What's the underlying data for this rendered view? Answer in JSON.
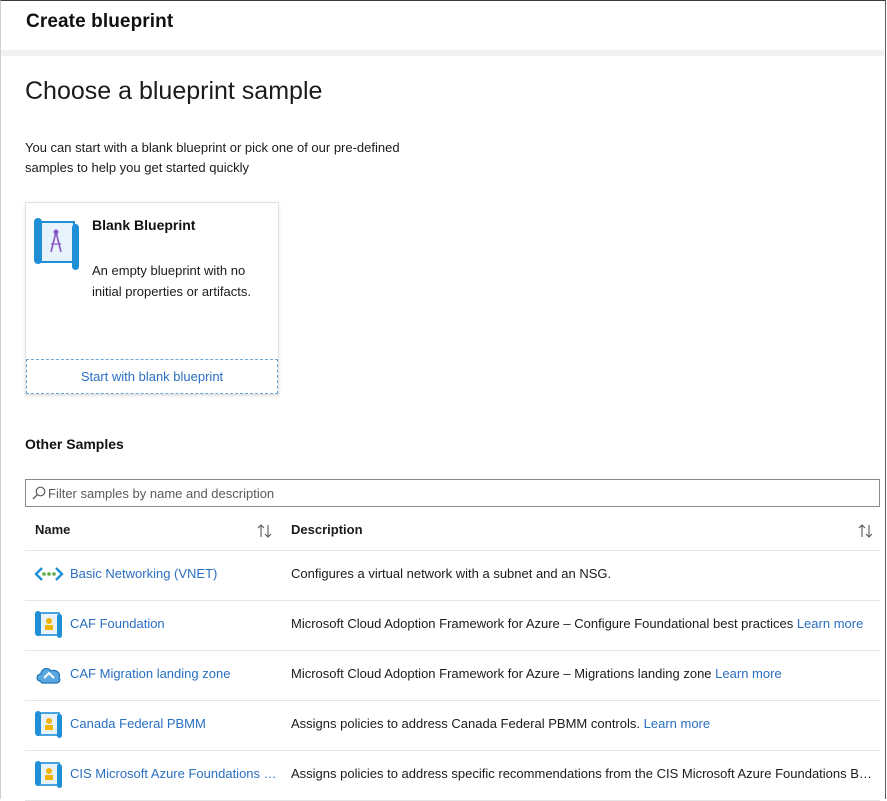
{
  "header": {
    "title": "Create blueprint"
  },
  "page": {
    "heading": "Choose a blueprint sample",
    "intro": "You can start with a blank blueprint or pick one of our pre-defined samples to help you get started quickly"
  },
  "blank_card": {
    "title": "Blank Blueprint",
    "description": "An empty blueprint with no initial properties or artifacts.",
    "action_label": "Start with blank blueprint"
  },
  "other_samples": {
    "heading": "Other Samples",
    "filter_placeholder": "Filter samples by name and description",
    "filter_value": "",
    "columns": {
      "name": "Name",
      "description": "Description"
    },
    "rows": [
      {
        "icon": "network-icon",
        "name": "Basic Networking (VNET)",
        "description": "Configures a virtual network with a subnet and an NSG.",
        "link": ""
      },
      {
        "icon": "blueprint-icon",
        "name": "CAF Foundation",
        "description": "Microsoft Cloud Adoption Framework for Azure – Configure Foundational best practices",
        "link": "Learn more"
      },
      {
        "icon": "migration-icon",
        "name": "CAF Migration landing zone",
        "description": "Microsoft Cloud Adoption Framework for Azure – Migrations landing zone",
        "link": "Learn more"
      },
      {
        "icon": "blueprint-icon",
        "name": "Canada Federal PBMM",
        "description": "Assigns policies to address Canada Federal PBMM controls.",
        "link": "Learn more"
      },
      {
        "icon": "blueprint-icon",
        "name": "CIS Microsoft Azure Foundations Ben...",
        "description": "Assigns policies to address specific recommendations from the CIS Microsoft Azure Foundations Benchmar...",
        "link": ""
      }
    ]
  },
  "colors": {
    "link": "#2a6fc0",
    "accent": "#1f8fd6",
    "border": "#e6e6e6"
  }
}
